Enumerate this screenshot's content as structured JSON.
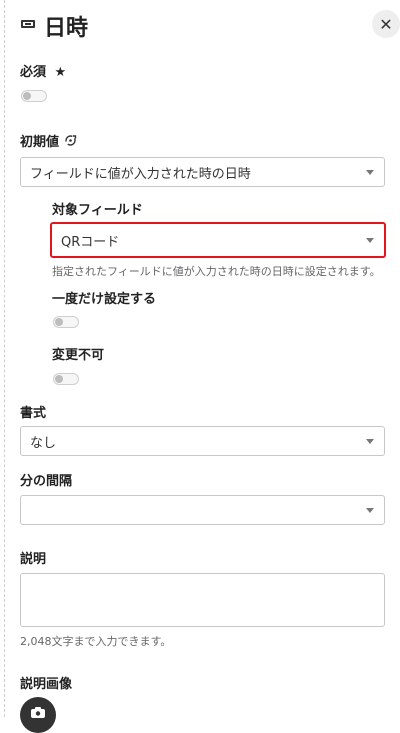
{
  "header": {
    "title": "日時",
    "close_glyph": "✕",
    "field_icon": "date-field-icon"
  },
  "required": {
    "label": "必須",
    "marker": "★",
    "enabled": false
  },
  "initial_value": {
    "label": "初期値",
    "icon": "sync-icon",
    "selected": "フィールドに値が入力された時の日時"
  },
  "target_field": {
    "label": "対象フィールド",
    "selected": "QRコード",
    "help": "指定されたフィールドに値が入力された時の日時に設定されます。",
    "highlight_color": "#e3141b"
  },
  "set_once": {
    "label": "一度だけ設定する",
    "enabled": false
  },
  "immutable": {
    "label": "変更不可",
    "enabled": false
  },
  "format": {
    "label": "書式",
    "selected": "なし"
  },
  "minute_interval": {
    "label": "分の間隔",
    "selected": ""
  },
  "description": {
    "label": "説明",
    "value": "",
    "limit_text": "2,048文字まで入力できます。"
  },
  "description_image": {
    "label": "説明画像",
    "icon": "camera-icon"
  }
}
